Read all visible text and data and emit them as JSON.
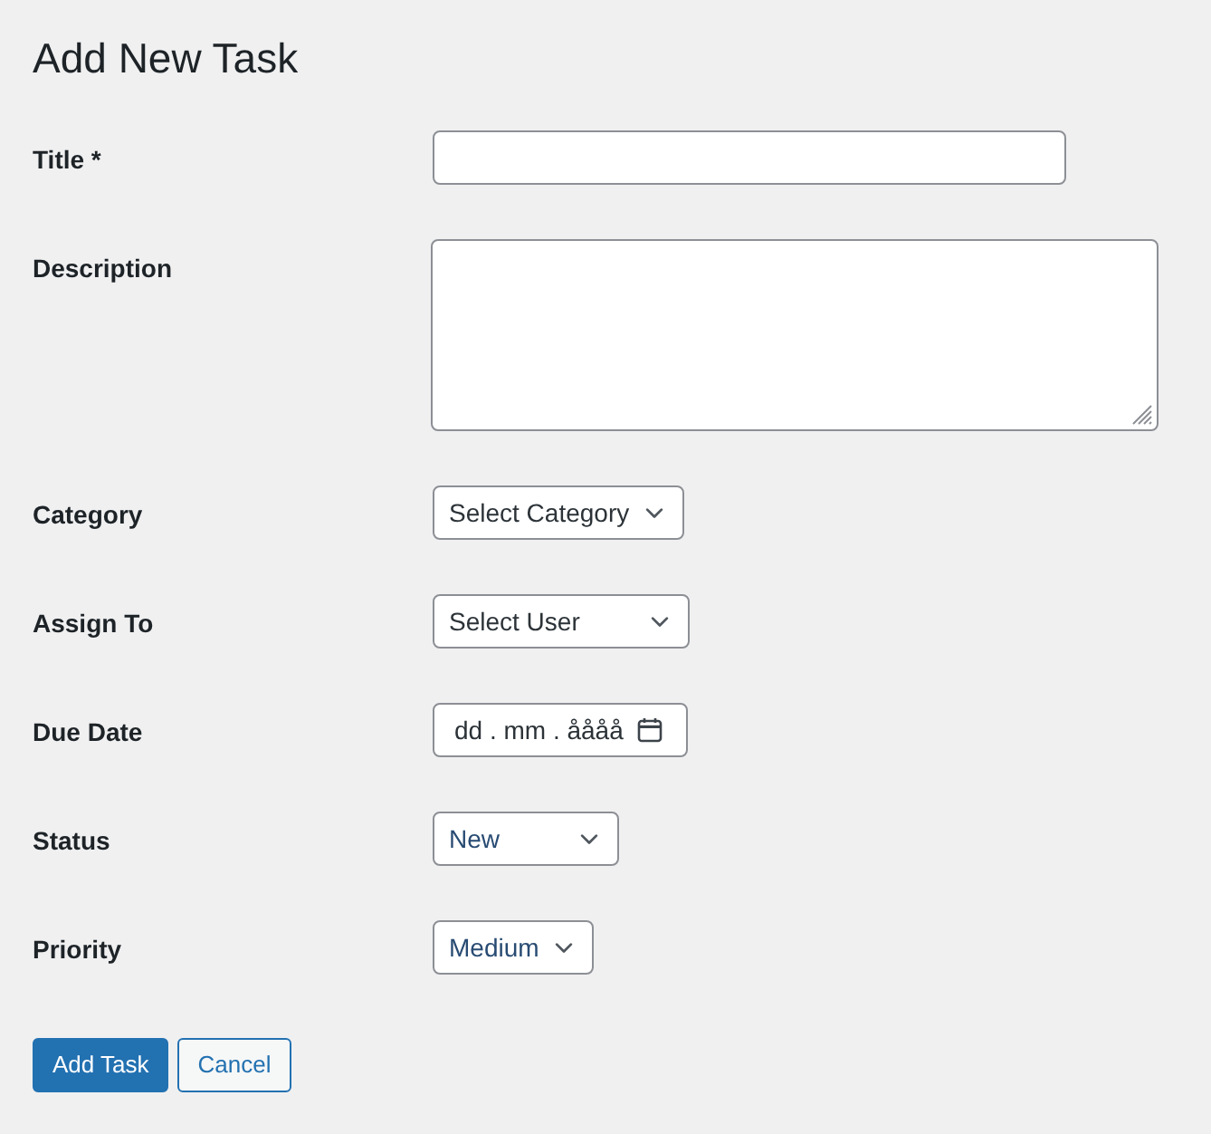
{
  "page_title": "Add New Task",
  "fields": [
    {
      "label": "Title *",
      "kind": "text"
    },
    {
      "label": "Description",
      "kind": "textarea"
    },
    {
      "label": "Category",
      "kind": "select",
      "placeholder": "Select Category"
    },
    {
      "label": "Assign To",
      "kind": "select",
      "placeholder": "Select User"
    },
    {
      "label": "Due Date",
      "kind": "date",
      "placeholder": "dd . mm . åååå"
    },
    {
      "label": "Status",
      "kind": "select",
      "value": "New"
    },
    {
      "label": "Priority",
      "kind": "select",
      "value": "Medium"
    }
  ],
  "buttons": [
    {
      "label": "Add Task",
      "kind": "primary"
    },
    {
      "label": "Cancel",
      "kind": "secondary"
    }
  ]
}
